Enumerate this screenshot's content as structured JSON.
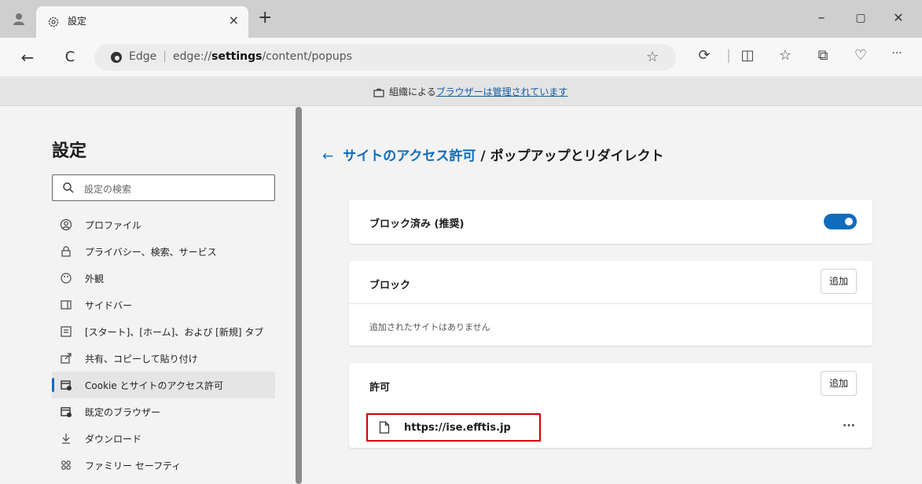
{
  "tab": {
    "title": "設定",
    "close_label": "×",
    "new_tab_label": "+"
  },
  "window": {
    "minimize": "–",
    "maximize": "▢",
    "close": "✕"
  },
  "toolbar": {
    "back": "←",
    "refresh": "C",
    "omnibox": {
      "brand": "Edge",
      "url_prefix": "edge://",
      "url_bold": "settings",
      "url_rest": "/content/popups"
    },
    "more": "···"
  },
  "banner": {
    "prefix": "組織による",
    "link": "ブラウザーは管理されています"
  },
  "sidebar": {
    "title": "設定",
    "search_placeholder": "設定の検索",
    "items": [
      {
        "label": "プロファイル",
        "icon": "profile-icon"
      },
      {
        "label": "プライバシー、検索、サービス",
        "icon": "lock-icon"
      },
      {
        "label": "外観",
        "icon": "appearance-icon"
      },
      {
        "label": "サイドバー",
        "icon": "sidebar-icon"
      },
      {
        "label": "[スタート]、[ホーム]、および [新規] タブ",
        "icon": "start-home-icon"
      },
      {
        "label": "共有、コピーして貼り付け",
        "icon": "share-icon"
      },
      {
        "label": "Cookie とサイトのアクセス許可",
        "icon": "cookie-icon",
        "active": true
      },
      {
        "label": "既定のブラウザー",
        "icon": "default-browser-icon"
      },
      {
        "label": "ダウンロード",
        "icon": "download-icon"
      },
      {
        "label": "ファミリー セーフティ",
        "icon": "family-icon"
      }
    ]
  },
  "main": {
    "breadcrumb": {
      "back": "←",
      "parent": "サイトのアクセス許可",
      "separator": "/",
      "current": "ポップアップとリダイレクト"
    },
    "blocked_setting": {
      "label": "ブロック済み (推奨)",
      "enabled": true
    },
    "block_section": {
      "title": "ブロック",
      "add_label": "追加",
      "empty_text": "追加されたサイトはありません"
    },
    "allow_section": {
      "title": "許可",
      "add_label": "追加",
      "sites": [
        {
          "url": "https://ise.efftis.jp",
          "more": "···"
        }
      ]
    }
  },
  "colors": {
    "accent": "#0f6cbd",
    "highlight_box": "#d10000"
  }
}
